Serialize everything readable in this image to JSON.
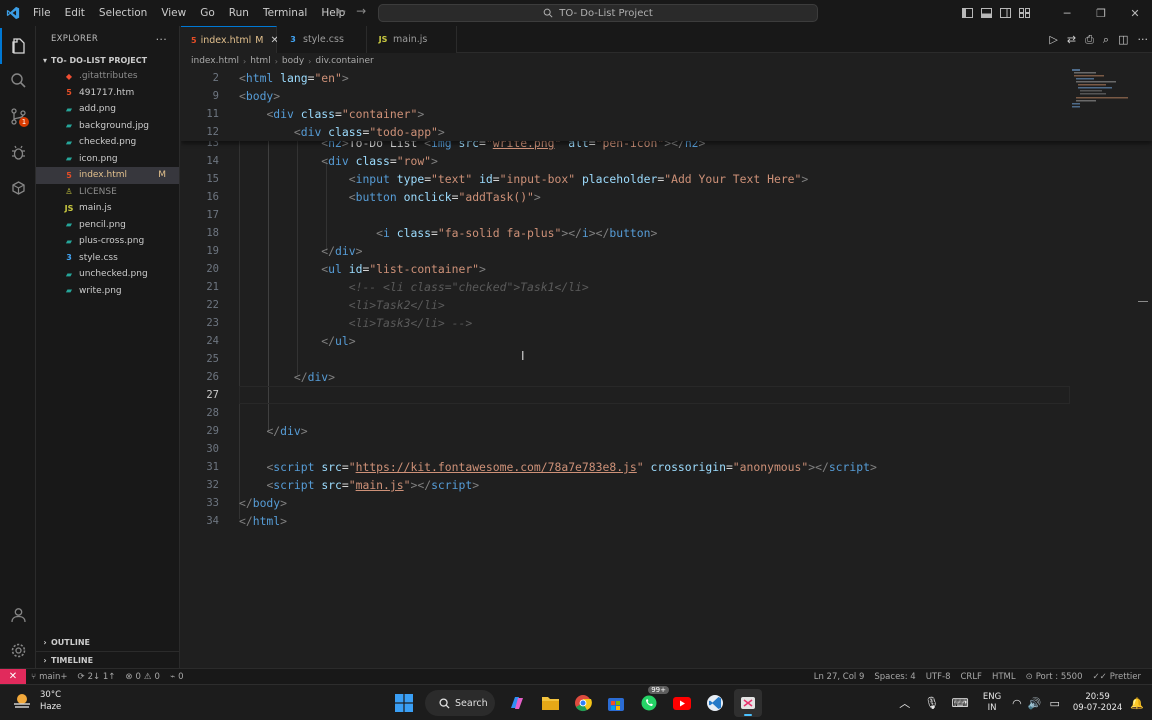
{
  "menu": [
    "File",
    "Edit",
    "Selection",
    "View",
    "Go",
    "Run",
    "Terminal",
    "Help"
  ],
  "command_center": {
    "text": "TO- Do-List Project"
  },
  "explorer": {
    "title": "EXPLORER",
    "folder": "TO- DO-LIST PROJECT",
    "files": [
      {
        "name": ".gitattributes",
        "icon": "git-icon",
        "icon_char": "◆",
        "color": "#f14e32",
        "git": true
      },
      {
        "name": "491717.htm",
        "icon": "html-file-icon",
        "icon_char": "5",
        "color": "#e44d26"
      },
      {
        "name": "add.png",
        "icon": "image-file-icon",
        "icon_char": "▰",
        "color": "#26a69a"
      },
      {
        "name": "background.jpg",
        "icon": "image-file-icon",
        "icon_char": "▰",
        "color": "#26a69a"
      },
      {
        "name": "checked.png",
        "icon": "image-file-icon",
        "icon_char": "▰",
        "color": "#26a69a"
      },
      {
        "name": "icon.png",
        "icon": "image-file-icon",
        "icon_char": "▰",
        "color": "#26a69a"
      },
      {
        "name": "index.html",
        "icon": "html-file-icon",
        "icon_char": "5",
        "color": "#e44d26",
        "status": "M",
        "selected": true
      },
      {
        "name": "LICENSE",
        "icon": "license-icon",
        "icon_char": "♙",
        "color": "#cbcb41",
        "git": true
      },
      {
        "name": "main.js",
        "icon": "js-file-icon",
        "icon_char": "JS",
        "color": "#cbcb41"
      },
      {
        "name": "pencil.png",
        "icon": "image-file-icon",
        "icon_char": "▰",
        "color": "#26a69a"
      },
      {
        "name": "plus-cross.png",
        "icon": "image-file-icon",
        "icon_char": "▰",
        "color": "#26a69a"
      },
      {
        "name": "style.css",
        "icon": "css-file-icon",
        "icon_char": "3",
        "color": "#42a5f5"
      },
      {
        "name": "unchecked.png",
        "icon": "image-file-icon",
        "icon_char": "▰",
        "color": "#26a69a"
      },
      {
        "name": "write.png",
        "icon": "image-file-icon",
        "icon_char": "▰",
        "color": "#26a69a"
      }
    ],
    "outline": "OUTLINE",
    "timeline": "TIMELINE"
  },
  "activity_badge": "1",
  "tabs": [
    {
      "label": "index.html",
      "modified": "M",
      "active": true,
      "icon": "html-file-icon",
      "icon_char": "5",
      "color": "#e44d26"
    },
    {
      "label": "style.css",
      "active": false,
      "icon": "css-file-icon",
      "icon_char": "3",
      "color": "#42a5f5"
    },
    {
      "label": "main.js",
      "active": false,
      "icon": "js-file-icon",
      "icon_char": "JS",
      "color": "#cbcb41"
    }
  ],
  "breadcrumb": [
    "index.html",
    "html",
    "body",
    "div.container"
  ],
  "editor": {
    "sticky_lines": [
      {
        "n": "2",
        "html": "<span class=\"t-br\">&lt;</span><span class=\"t-tag\">html</span> <span class=\"t-attr\">lang</span><span class=\"t-txt\">=</span><span class=\"t-str\">\"en\"</span><span class=\"t-br\">&gt;</span>"
      },
      {
        "n": "9",
        "html": "<span class=\"t-br\">&lt;</span><span class=\"t-tag\">body</span><span class=\"t-br\">&gt;</span>"
      },
      {
        "n": "11",
        "html": "    <span class=\"t-br\">&lt;</span><span class=\"t-tag\">div</span> <span class=\"t-attr\">class</span><span class=\"t-txt\">=</span><span class=\"t-str\">\"container\"</span><span class=\"t-br\">&gt;</span>"
      },
      {
        "n": "12",
        "html": "        <span class=\"t-br\">&lt;</span><span class=\"t-tag\">div</span> <span class=\"t-attr\">class</span><span class=\"t-txt\">=</span><span class=\"t-str\">\"todo-app\"</span><span class=\"t-br\">&gt;</span>"
      }
    ],
    "lines": [
      {
        "n": "13",
        "html": "            <span class=\"t-br\">&lt;</span><span class=\"t-tag\">h2</span><span class=\"t-br\">&gt;</span><span class=\"t-txt\">To-Do List </span><span class=\"t-br\">&lt;</span><span class=\"t-tag\">img</span> <span class=\"t-attr\">src</span><span class=\"t-txt\">=</span><span class=\"t-str\">\"<u>write.png</u>\"</span> <span class=\"t-attr\">alt</span><span class=\"t-txt\">=</span><span class=\"t-str\">\"pen-icon\"</span><span class=\"t-br\">&gt;&lt;/</span><span class=\"t-tag\">h2</span><span class=\"t-br\">&gt;</span>"
      },
      {
        "n": "14",
        "html": "            <span class=\"t-br\">&lt;</span><span class=\"t-tag\">div</span> <span class=\"t-attr\">class</span><span class=\"t-txt\">=</span><span class=\"t-str\">\"row\"</span><span class=\"t-br\">&gt;</span>"
      },
      {
        "n": "15",
        "html": "                <span class=\"t-br\">&lt;</span><span class=\"t-tag\">input</span> <span class=\"t-attr\">type</span><span class=\"t-txt\">=</span><span class=\"t-str\">\"text\"</span> <span class=\"t-attr\">id</span><span class=\"t-txt\">=</span><span class=\"t-str\">\"input-box\"</span> <span class=\"t-attr\">placeholder</span><span class=\"t-txt\">=</span><span class=\"t-str\">\"Add Your Text Here\"</span><span class=\"t-br\">&gt;</span>"
      },
      {
        "n": "16",
        "html": "                <span class=\"t-br\">&lt;</span><span class=\"t-tag\">button</span> <span class=\"t-attr\">onclick</span><span class=\"t-txt\">=</span><span class=\"t-str\">\"addTask()\"</span><span class=\"t-br\">&gt;</span>"
      },
      {
        "n": "17",
        "html": ""
      },
      {
        "n": "18",
        "html": "                    <span class=\"t-br\">&lt;</span><span class=\"t-tag\">i</span> <span class=\"t-attr\">class</span><span class=\"t-txt\">=</span><span class=\"t-str\">\"fa-solid fa-plus\"</span><span class=\"t-br\">&gt;&lt;/</span><span class=\"t-tag\">i</span><span class=\"t-br\">&gt;&lt;/</span><span class=\"t-tag\">button</span><span class=\"t-br\">&gt;</span>"
      },
      {
        "n": "19",
        "html": "            <span class=\"t-br\">&lt;/</span><span class=\"t-tag\">div</span><span class=\"t-br\">&gt;</span>"
      },
      {
        "n": "20",
        "html": "            <span class=\"t-br\">&lt;</span><span class=\"t-tag\">ul</span> <span class=\"t-attr\">id</span><span class=\"t-txt\">=</span><span class=\"t-str\">\"list-container\"</span><span class=\"t-br\">&gt;</span>"
      },
      {
        "n": "21",
        "html": "                <span class=\"t-cm2\">&lt;!-- &lt;li class=\"checked\"&gt;Task1&lt;/li&gt;</span>"
      },
      {
        "n": "22",
        "html": "                <span class=\"t-cm2\">&lt;li&gt;Task2&lt;/li&gt;</span>"
      },
      {
        "n": "23",
        "html": "                <span class=\"t-cm2\">&lt;li&gt;Task3&lt;/li&gt; --&gt;</span>"
      },
      {
        "n": "24",
        "html": "            <span class=\"t-br\">&lt;/</span><span class=\"t-tag\">ul</span><span class=\"t-br\">&gt;</span>"
      },
      {
        "n": "25",
        "html": ""
      },
      {
        "n": "26",
        "html": "        <span class=\"t-br\">&lt;/</span><span class=\"t-tag\">div</span><span class=\"t-br\">&gt;</span>"
      },
      {
        "n": "27",
        "html": "",
        "current": true
      },
      {
        "n": "28",
        "html": ""
      },
      {
        "n": "29",
        "html": "    <span class=\"t-br\">&lt;/</span><span class=\"t-tag\">div</span><span class=\"t-br\">&gt;</span>"
      },
      {
        "n": "30",
        "html": ""
      },
      {
        "n": "31",
        "html": "    <span class=\"t-br\">&lt;</span><span class=\"t-tag\">script</span> <span class=\"t-attr\">src</span><span class=\"t-txt\">=</span><span class=\"t-str\">\"<u>https://kit.fontawesome.com/78a7e783e8.js</u>\"</span> <span class=\"t-attr\">crossorigin</span><span class=\"t-txt\">=</span><span class=\"t-str\">\"anonymous\"</span><span class=\"t-br\">&gt;&lt;/</span><span class=\"t-tag\">script</span><span class=\"t-br\">&gt;</span>"
      },
      {
        "n": "32",
        "html": "    <span class=\"t-br\">&lt;</span><span class=\"t-tag\">script</span> <span class=\"t-attr\">src</span><span class=\"t-txt\">=</span><span class=\"t-str\">\"<u>main.js</u>\"</span><span class=\"t-br\">&gt;&lt;/</span><span class=\"t-tag\">script</span><span class=\"t-br\">&gt;</span>"
      },
      {
        "n": "33",
        "html": "<span class=\"t-br\">&lt;/</span><span class=\"t-tag\">body</span><span class=\"t-br\">&gt;</span>"
      },
      {
        "n": "34",
        "html": "<span class=\"t-br\">&lt;/</span><span class=\"t-tag\">html</span><span class=\"t-br\">&gt;</span>"
      }
    ]
  },
  "status": {
    "branch": "main+",
    "sync": "2↓ 1↑",
    "errors": "0",
    "warnings": "0",
    "ports": "0",
    "position": "Ln 27, Col 9",
    "spaces": "Spaces: 4",
    "encoding": "UTF-8",
    "eol": "CRLF",
    "language": "HTML",
    "port": "Port : 5500",
    "prettier": "Prettier"
  },
  "taskbar": {
    "temp": "30°C",
    "weather": "Haze",
    "search_label": "Search",
    "whatsapp_badge": "99+",
    "lang": "ENG",
    "region": "IN",
    "time": "20:59",
    "date": "09-07-2024"
  },
  "colors": {
    "accent": "#0078d4",
    "remote": "#e12a5c",
    "modified": "#e2c08d"
  }
}
